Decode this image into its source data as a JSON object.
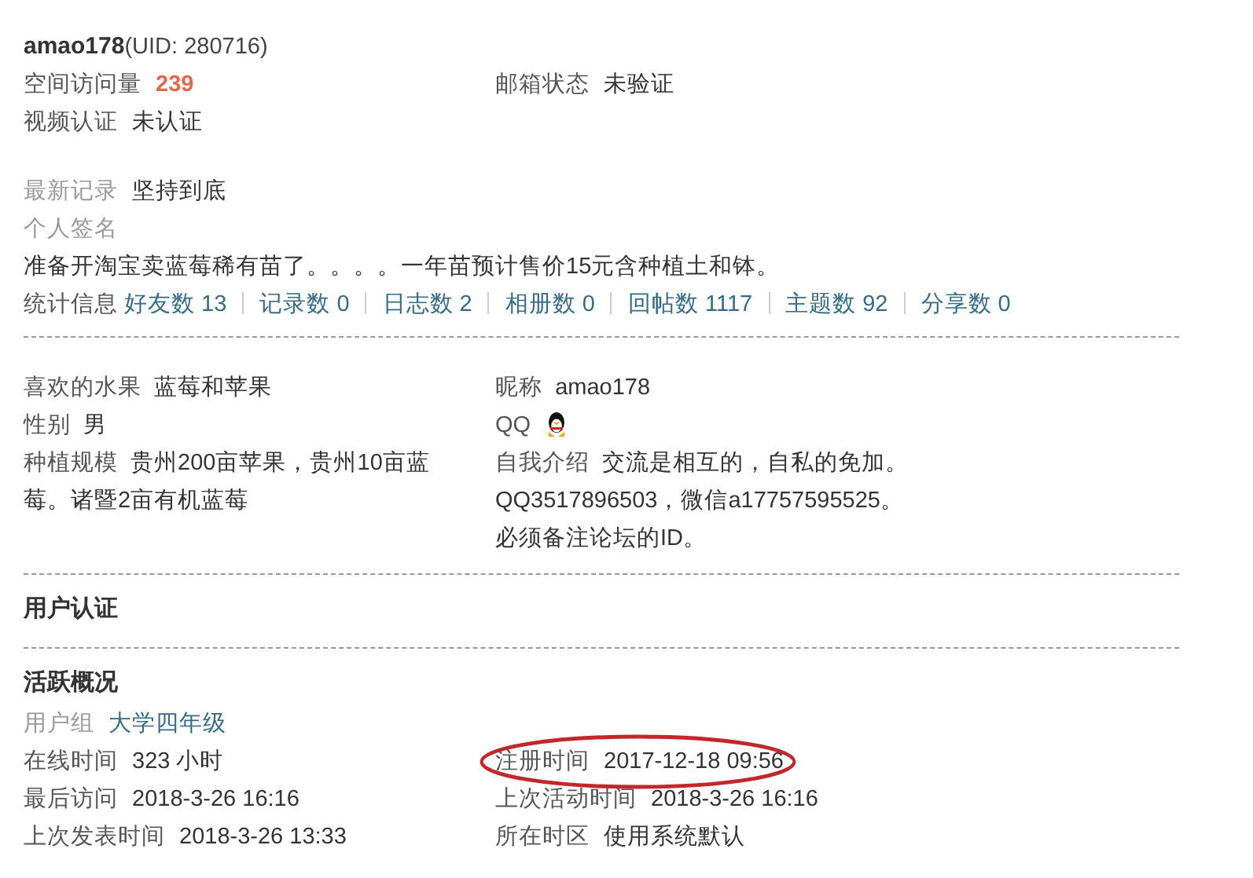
{
  "header": {
    "username": "amao178",
    "uid": "(UID: 280716)"
  },
  "overview": {
    "rows": [
      {
        "left": {
          "label": "空间访问量",
          "value": "239",
          "kind": "count"
        },
        "right": {
          "label": "邮箱状态",
          "value": "未验证",
          "kind": "text"
        }
      },
      {
        "left": {
          "label": "视频认证",
          "value": "未认证",
          "kind": "text"
        }
      }
    ],
    "latest": {
      "label": "最新记录",
      "value": "坚持到底"
    },
    "signature": {
      "label": "个人签名",
      "text": "准备开淘宝卖蓝莓稀有苗了。。。。一年苗预计售价15元含种植土和钵。"
    },
    "stats": {
      "label": "统计信息",
      "links": [
        "好友数 13",
        "记录数 0",
        "日志数 2",
        "相册数 0",
        "回帖数 1117",
        "主题数 92",
        "分享数 0"
      ]
    }
  },
  "profile": {
    "left": [
      {
        "label": "喜欢的水果",
        "lines": [
          "蓝莓和苹果"
        ],
        "kind": "text"
      },
      {
        "label": "性别",
        "lines": [
          "男"
        ],
        "kind": "text"
      },
      {
        "label": "种植规模",
        "lines": [
          "贵州200亩苹果，贵州10亩蓝莓。诸暨2亩有机蓝莓"
        ],
        "kind": "text"
      }
    ],
    "right": [
      {
        "label": "昵称",
        "lines": [
          "amao178"
        ],
        "kind": "text"
      },
      {
        "label": "QQ",
        "kind": "qq"
      },
      {
        "label": "自我介绍",
        "lines": [
          "交流是相互的，自私的免加。",
          "QQ3517896503，微信a17757595525。",
          "必须备注论坛的ID。"
        ],
        "kind": "text"
      }
    ]
  },
  "verification": {
    "heading": "用户认证"
  },
  "activity": {
    "heading": "活跃概况",
    "group": {
      "label": "用户组",
      "value": "大学四年级"
    },
    "rows": [
      {
        "left": {
          "label": "在线时间",
          "value": "323 小时",
          "circled": false
        },
        "right": {
          "label": "注册时间",
          "value": "2017-12-18 09:56",
          "circled": true
        }
      },
      {
        "left": {
          "label": "最后访问",
          "value": "2018-3-26 16:16",
          "circled": false
        },
        "right": {
          "label": "上次活动时间",
          "value": "2018-3-26 16:16",
          "circled": false
        }
      },
      {
        "left": {
          "label": "上次发表时间",
          "value": "2018-3-26 13:33",
          "circled": false
        },
        "right": {
          "label": "所在时区",
          "value": "使用系统默认",
          "circled": false
        }
      }
    ]
  }
}
